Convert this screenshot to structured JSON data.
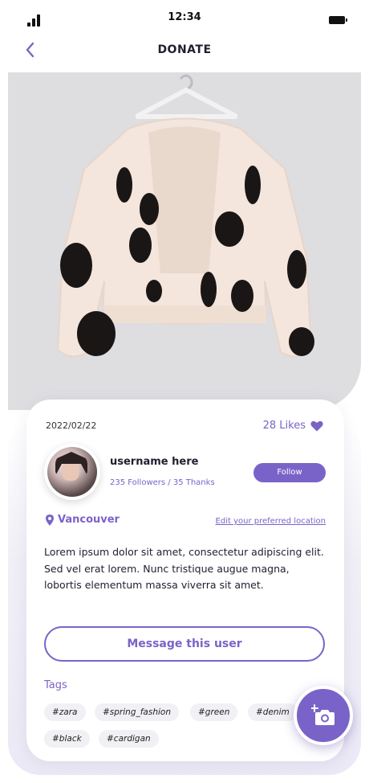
{
  "status_bar": {
    "time": "12:34",
    "signal_icon": "signal-bars-icon",
    "battery_icon": "battery-icon"
  },
  "nav": {
    "back_icon": "chevron-left-icon",
    "title": "DONATE"
  },
  "colors": {
    "accent": "#7a63c8",
    "text": "#1f1f2e",
    "tag_bg": "#f1f0f4"
  },
  "post": {
    "image_icon": "cardigan-photo",
    "date": "2022/02/22",
    "likes": "28 Likes",
    "likes_icon": "heart-icon",
    "user": {
      "name": "username here",
      "stats": "235 Followers / 35 Thanks",
      "follow_label": "Follow"
    },
    "location": {
      "icon": "map-pin-icon",
      "name": "Vancouver",
      "edit_label": "Edit your preferred location"
    },
    "description": "Lorem ipsum dolor sit amet, consectetur adipiscing elit. Sed vel erat lorem. Nunc tristique augue magna, lobortis elementum massa viverra sit amet.",
    "message_label": "Message this user",
    "tags_label": "Tags",
    "tags": [
      "#zara",
      "#spring_fashion",
      "#green",
      "#denim",
      "#black",
      "#cardigan"
    ]
  },
  "fab": {
    "icon": "add-photo-icon"
  }
}
